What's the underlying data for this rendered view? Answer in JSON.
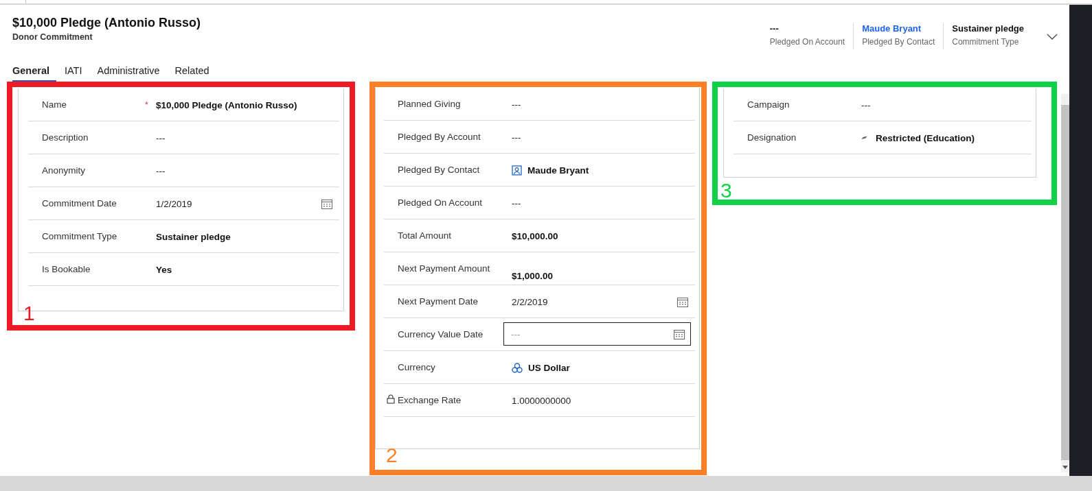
{
  "header": {
    "title": "$10,000 Pledge (Antonio Russo)",
    "subtitle": "Donor Commitment",
    "fields": [
      {
        "value": "---",
        "label": "Pledged On Account",
        "kind": "text"
      },
      {
        "value": "Maude Bryant",
        "label": "Pledged By Contact",
        "kind": "link"
      },
      {
        "value": "Sustainer pledge",
        "label": "Commitment Type",
        "kind": "text"
      }
    ]
  },
  "tabs": [
    {
      "label": "General",
      "selected": true
    },
    {
      "label": "IATI",
      "selected": false
    },
    {
      "label": "Administrative",
      "selected": false
    },
    {
      "label": "Related",
      "selected": false
    }
  ],
  "sections": [
    {
      "annotation": {
        "number": "1",
        "color": "#ed1c24"
      },
      "fields": [
        {
          "label": "Name",
          "required_mark": "*",
          "kind": "bold",
          "value": "$10,000 Pledge (Antonio Russo)",
          "locked": false
        },
        {
          "label": "Description",
          "kind": "text",
          "value": "---",
          "locked": false
        },
        {
          "label": "Anonymity",
          "kind": "text",
          "value": "---",
          "locked": false
        },
        {
          "label": "Commitment Date",
          "kind": "date",
          "value": "1/2/2019",
          "locked": false
        },
        {
          "label": "Commitment Type",
          "kind": "bold",
          "value": "Sustainer pledge",
          "locked": false
        },
        {
          "label": "Is Bookable",
          "kind": "bold",
          "value": "Yes",
          "locked": false
        }
      ]
    },
    {
      "annotation": {
        "number": "2",
        "color": "#ff7f27"
      },
      "fields": [
        {
          "label": "Planned Giving",
          "kind": "text",
          "value": "---",
          "locked": false
        },
        {
          "label": "Pledged By Account",
          "kind": "text",
          "value": "---",
          "locked": false
        },
        {
          "label": "Pledged By Contact",
          "kind": "contact",
          "value": "Maude Bryant",
          "locked": false
        },
        {
          "label": "Pledged On Account",
          "kind": "text",
          "value": "---",
          "locked": false
        },
        {
          "label": "Total Amount",
          "kind": "bold",
          "value": "$10,000.00",
          "locked": false
        },
        {
          "label": "Next Payment Amount",
          "kind": "bold",
          "value": "$1,000.00",
          "locked": false
        },
        {
          "label": "Next Payment Date",
          "kind": "date",
          "value": "2/2/2019",
          "locked": false
        },
        {
          "label": "Currency Value Date",
          "kind": "input",
          "placeholder": "---",
          "locked": false
        },
        {
          "label": "Currency",
          "kind": "currency",
          "value": "US Dollar",
          "locked": false
        },
        {
          "label": "Exchange Rate",
          "kind": "text",
          "value": "1.0000000000",
          "locked": true
        }
      ]
    },
    {
      "annotation": {
        "number": "3",
        "color": "#0fd148"
      },
      "fields": [
        {
          "label": "Campaign",
          "kind": "text",
          "value": "---",
          "locked": false
        },
        {
          "label": "Designation",
          "kind": "record",
          "value": "Restricted (Education)",
          "locked": false
        }
      ]
    }
  ]
}
